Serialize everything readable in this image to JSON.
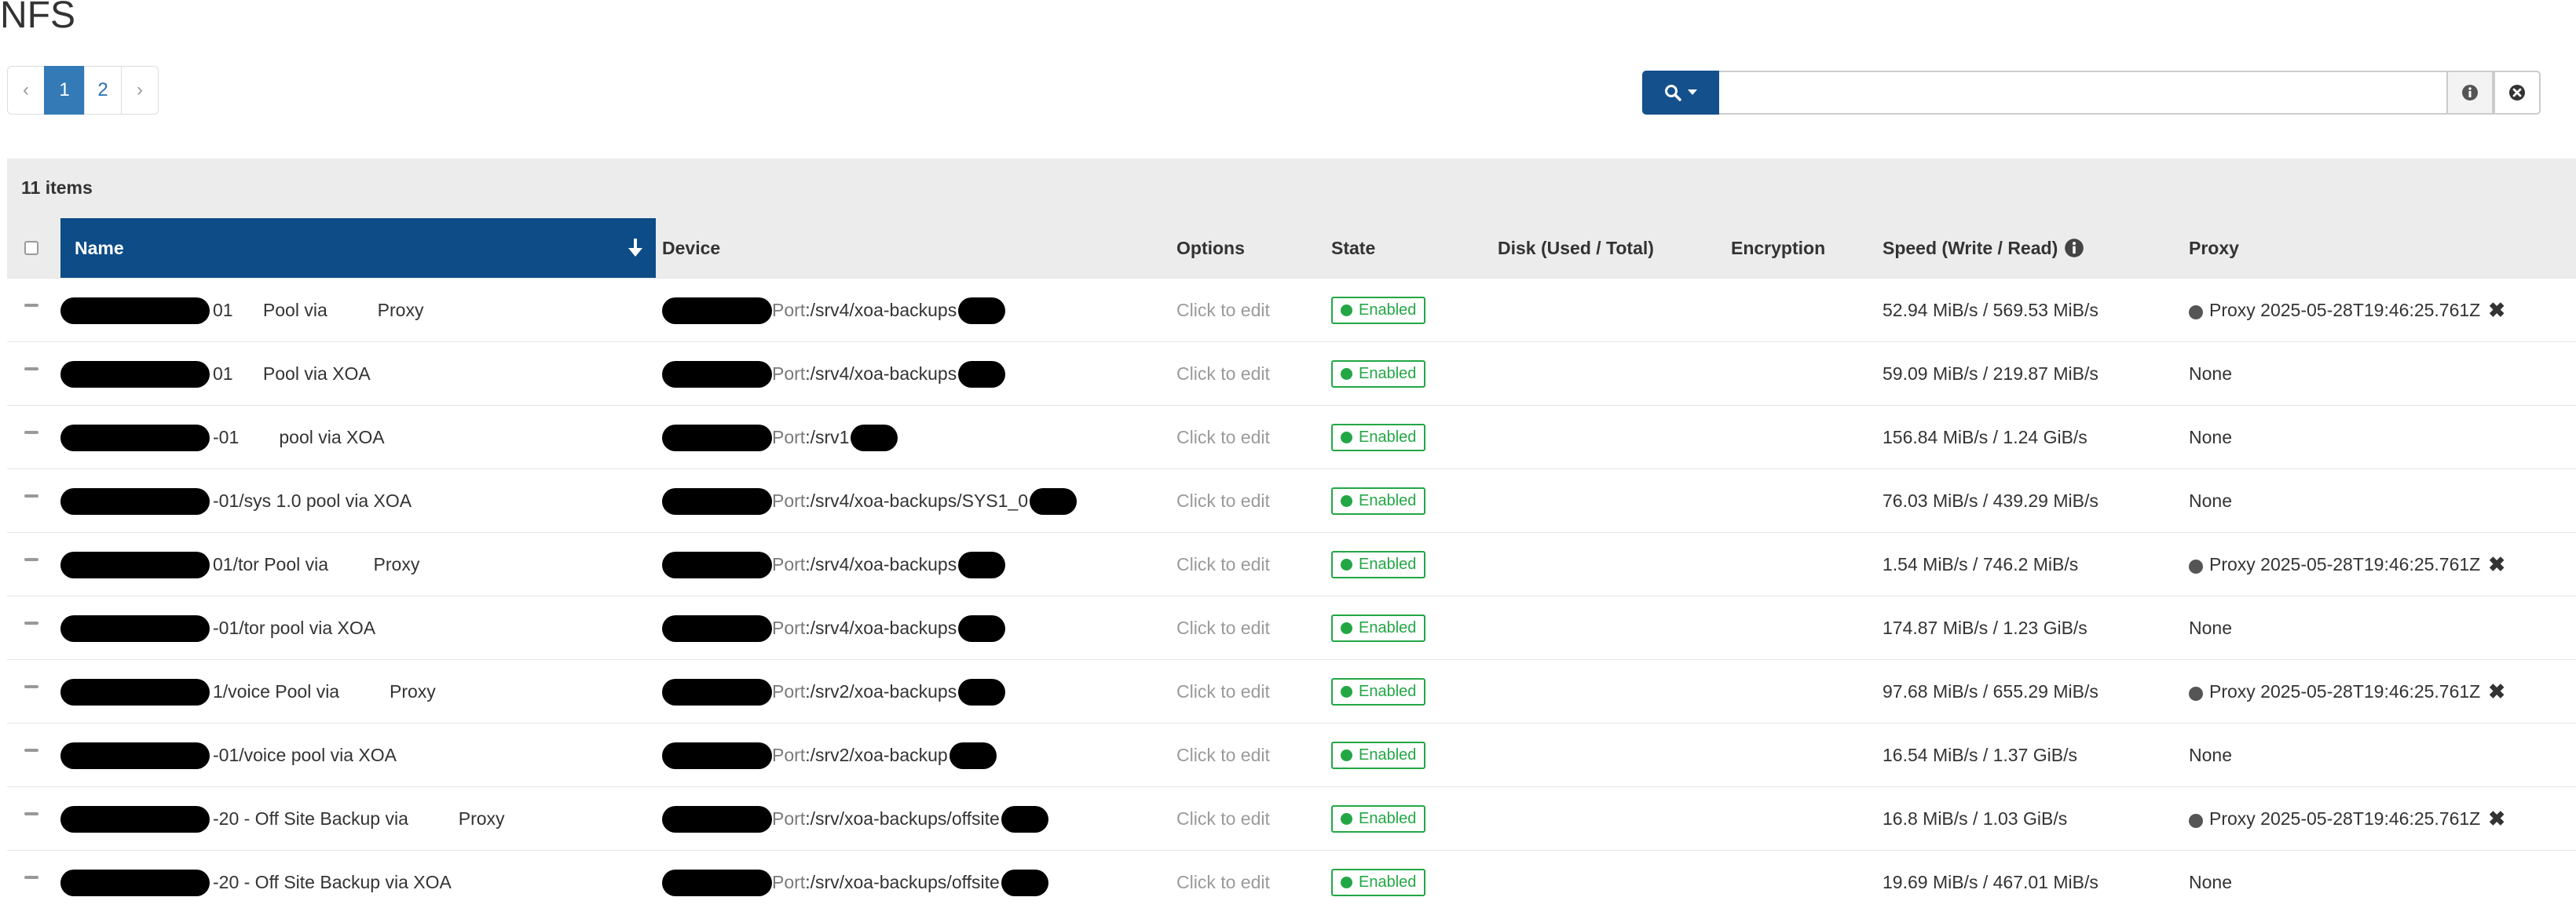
{
  "page": {
    "title": "NFS"
  },
  "pagination": {
    "prev": "‹",
    "pages": [
      "1",
      "2"
    ],
    "active": "1",
    "next": "›"
  },
  "search": {
    "placeholder": "",
    "value": "",
    "button_icon": "search-icon",
    "info_icon": "info-icon",
    "clear_icon": "close-circle-icon"
  },
  "table": {
    "count_label": "11 items",
    "columns": {
      "name": "Name",
      "device": "Device",
      "options": "Options",
      "state": "State",
      "disk": "Disk (Used / Total)",
      "encryption": "Encryption",
      "speed": "Speed (Write / Read)",
      "proxy": "Proxy"
    },
    "rows": [
      {
        "name": "01      Pool via          Proxy",
        "port": "Port",
        "path": ":/srv4/xoa-backups",
        "options": "Click to edit",
        "state": "Enabled",
        "speed": "52.94 MiB/s / 569.53 MiB/s",
        "proxy": "Proxy 2025-05-28T19:46:25.761Z",
        "has_proxy": true
      },
      {
        "name": "01      Pool via XOA",
        "port": "Port",
        "path": ":/srv4/xoa-backups",
        "options": "Click to edit",
        "state": "Enabled",
        "speed": "59.09 MiB/s / 219.87 MiB/s",
        "proxy": "None",
        "has_proxy": false
      },
      {
        "name": "-01        pool via XOA",
        "port": "Port",
        "path": ":/srv1",
        "options": "Click to edit",
        "state": "Enabled",
        "speed": "156.84 MiB/s / 1.24 GiB/s",
        "proxy": "None",
        "has_proxy": false
      },
      {
        "name": "-01/sys 1.0 pool via XOA",
        "port": "Port",
        "path": ":/srv4/xoa-backups/SYS1_0",
        "options": "Click to edit",
        "state": "Enabled",
        "speed": "76.03 MiB/s / 439.29 MiB/s",
        "proxy": "None",
        "has_proxy": false
      },
      {
        "name": "01/tor Pool via         Proxy",
        "port": "Port",
        "path": ":/srv4/xoa-backups",
        "options": "Click to edit",
        "state": "Enabled",
        "speed": "1.54 MiB/s / 746.2 MiB/s",
        "proxy": "Proxy 2025-05-28T19:46:25.761Z",
        "has_proxy": true
      },
      {
        "name": "-01/tor pool via XOA",
        "port": "Port",
        "path": ":/srv4/xoa-backups",
        "options": "Click to edit",
        "state": "Enabled",
        "speed": "174.87 MiB/s / 1.23 GiB/s",
        "proxy": "None",
        "has_proxy": false
      },
      {
        "name": "1/voice Pool via          Proxy",
        "port": "Port",
        "path": ":/srv2/xoa-backups",
        "options": "Click to edit",
        "state": "Enabled",
        "speed": "97.68 MiB/s / 655.29 MiB/s",
        "proxy": "Proxy 2025-05-28T19:46:25.761Z",
        "has_proxy": true
      },
      {
        "name": "-01/voice pool via XOA",
        "port": "Port",
        "path": ":/srv2/xoa-backup",
        "options": "Click to edit",
        "state": "Enabled",
        "speed": "16.54 MiB/s / 1.37 GiB/s",
        "proxy": "None",
        "has_proxy": false
      },
      {
        "name": "-20 - Off Site Backup via          Proxy",
        "port": "Port",
        "path": ":/srv/xoa-backups/offsite",
        "options": "Click to edit",
        "state": "Enabled",
        "speed": "16.8 MiB/s / 1.03 GiB/s",
        "proxy": "Proxy 2025-05-28T19:46:25.761Z",
        "has_proxy": true
      },
      {
        "name": "-20 - Off Site Backup via XOA",
        "port": "Port",
        "path": ":/srv/xoa-backups/offsite",
        "options": "Click to edit",
        "state": "Enabled",
        "speed": "19.69 MiB/s / 467.01 MiB/s",
        "proxy": "None",
        "has_proxy": false
      }
    ]
  },
  "colors": {
    "sorted_header": "#0d4c87",
    "search_button": "#14508c",
    "enabled": "#23a745",
    "pagination_active": "#337ab7"
  }
}
